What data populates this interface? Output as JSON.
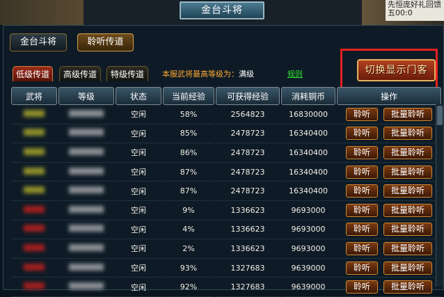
{
  "window": {
    "title": "金台斗将",
    "corner_text": "先恒庞好礼回馈 五00:0"
  },
  "top_buttons": [
    {
      "label": "金台斗将",
      "active": false
    },
    {
      "label": "聆听传道",
      "active": true
    }
  ],
  "tabs": [
    {
      "label": "低级传道",
      "active": true
    },
    {
      "label": "高级传道",
      "active": false
    },
    {
      "label": "特级传道",
      "active": false
    }
  ],
  "info": {
    "server_max_label": "本服武将最高等级为：",
    "server_max_value": "满级",
    "rules_link": "规则"
  },
  "switch_button": "切换显示门客",
  "table": {
    "headers": [
      "武将",
      "等级",
      "状态",
      "当前经验",
      "可获得经验",
      "消耗铜币",
      "操作"
    ],
    "rows": [
      {
        "name_color": "#8f8f2a",
        "status": "空闲",
        "current_exp": "58%",
        "gain_exp": "2564823",
        "cost": "16830000"
      },
      {
        "name_color": "#8f8f2a",
        "status": "空闲",
        "current_exp": "85%",
        "gain_exp": "2478723",
        "cost": "16340400"
      },
      {
        "name_color": "#8f8f2a",
        "status": "空闲",
        "current_exp": "86%",
        "gain_exp": "2478723",
        "cost": "16340400"
      },
      {
        "name_color": "#8f8f2a",
        "status": "空闲",
        "current_exp": "87%",
        "gain_exp": "2478723",
        "cost": "16340400"
      },
      {
        "name_color": "#8f8f2a",
        "status": "空闲",
        "current_exp": "87%",
        "gain_exp": "2478723",
        "cost": "16340400"
      },
      {
        "name_color": "#a11f1f",
        "status": "空闲",
        "current_exp": "9%",
        "gain_exp": "1336623",
        "cost": "9693000"
      },
      {
        "name_color": "#a11f1f",
        "status": "空闲",
        "current_exp": "4%",
        "gain_exp": "1336623",
        "cost": "9693000"
      },
      {
        "name_color": "#a11f1f",
        "status": "空闲",
        "current_exp": "2%",
        "gain_exp": "1336623",
        "cost": "9693000"
      },
      {
        "name_color": "#a11f1f",
        "status": "空闲",
        "current_exp": "93%",
        "gain_exp": "1327683",
        "cost": "9639000"
      },
      {
        "name_color": "#a11f1f",
        "status": "空闲",
        "current_exp": "92%",
        "gain_exp": "1327683",
        "cost": "9639000"
      }
    ],
    "listen_label": "聆听",
    "batch_label": "批量聆听"
  }
}
